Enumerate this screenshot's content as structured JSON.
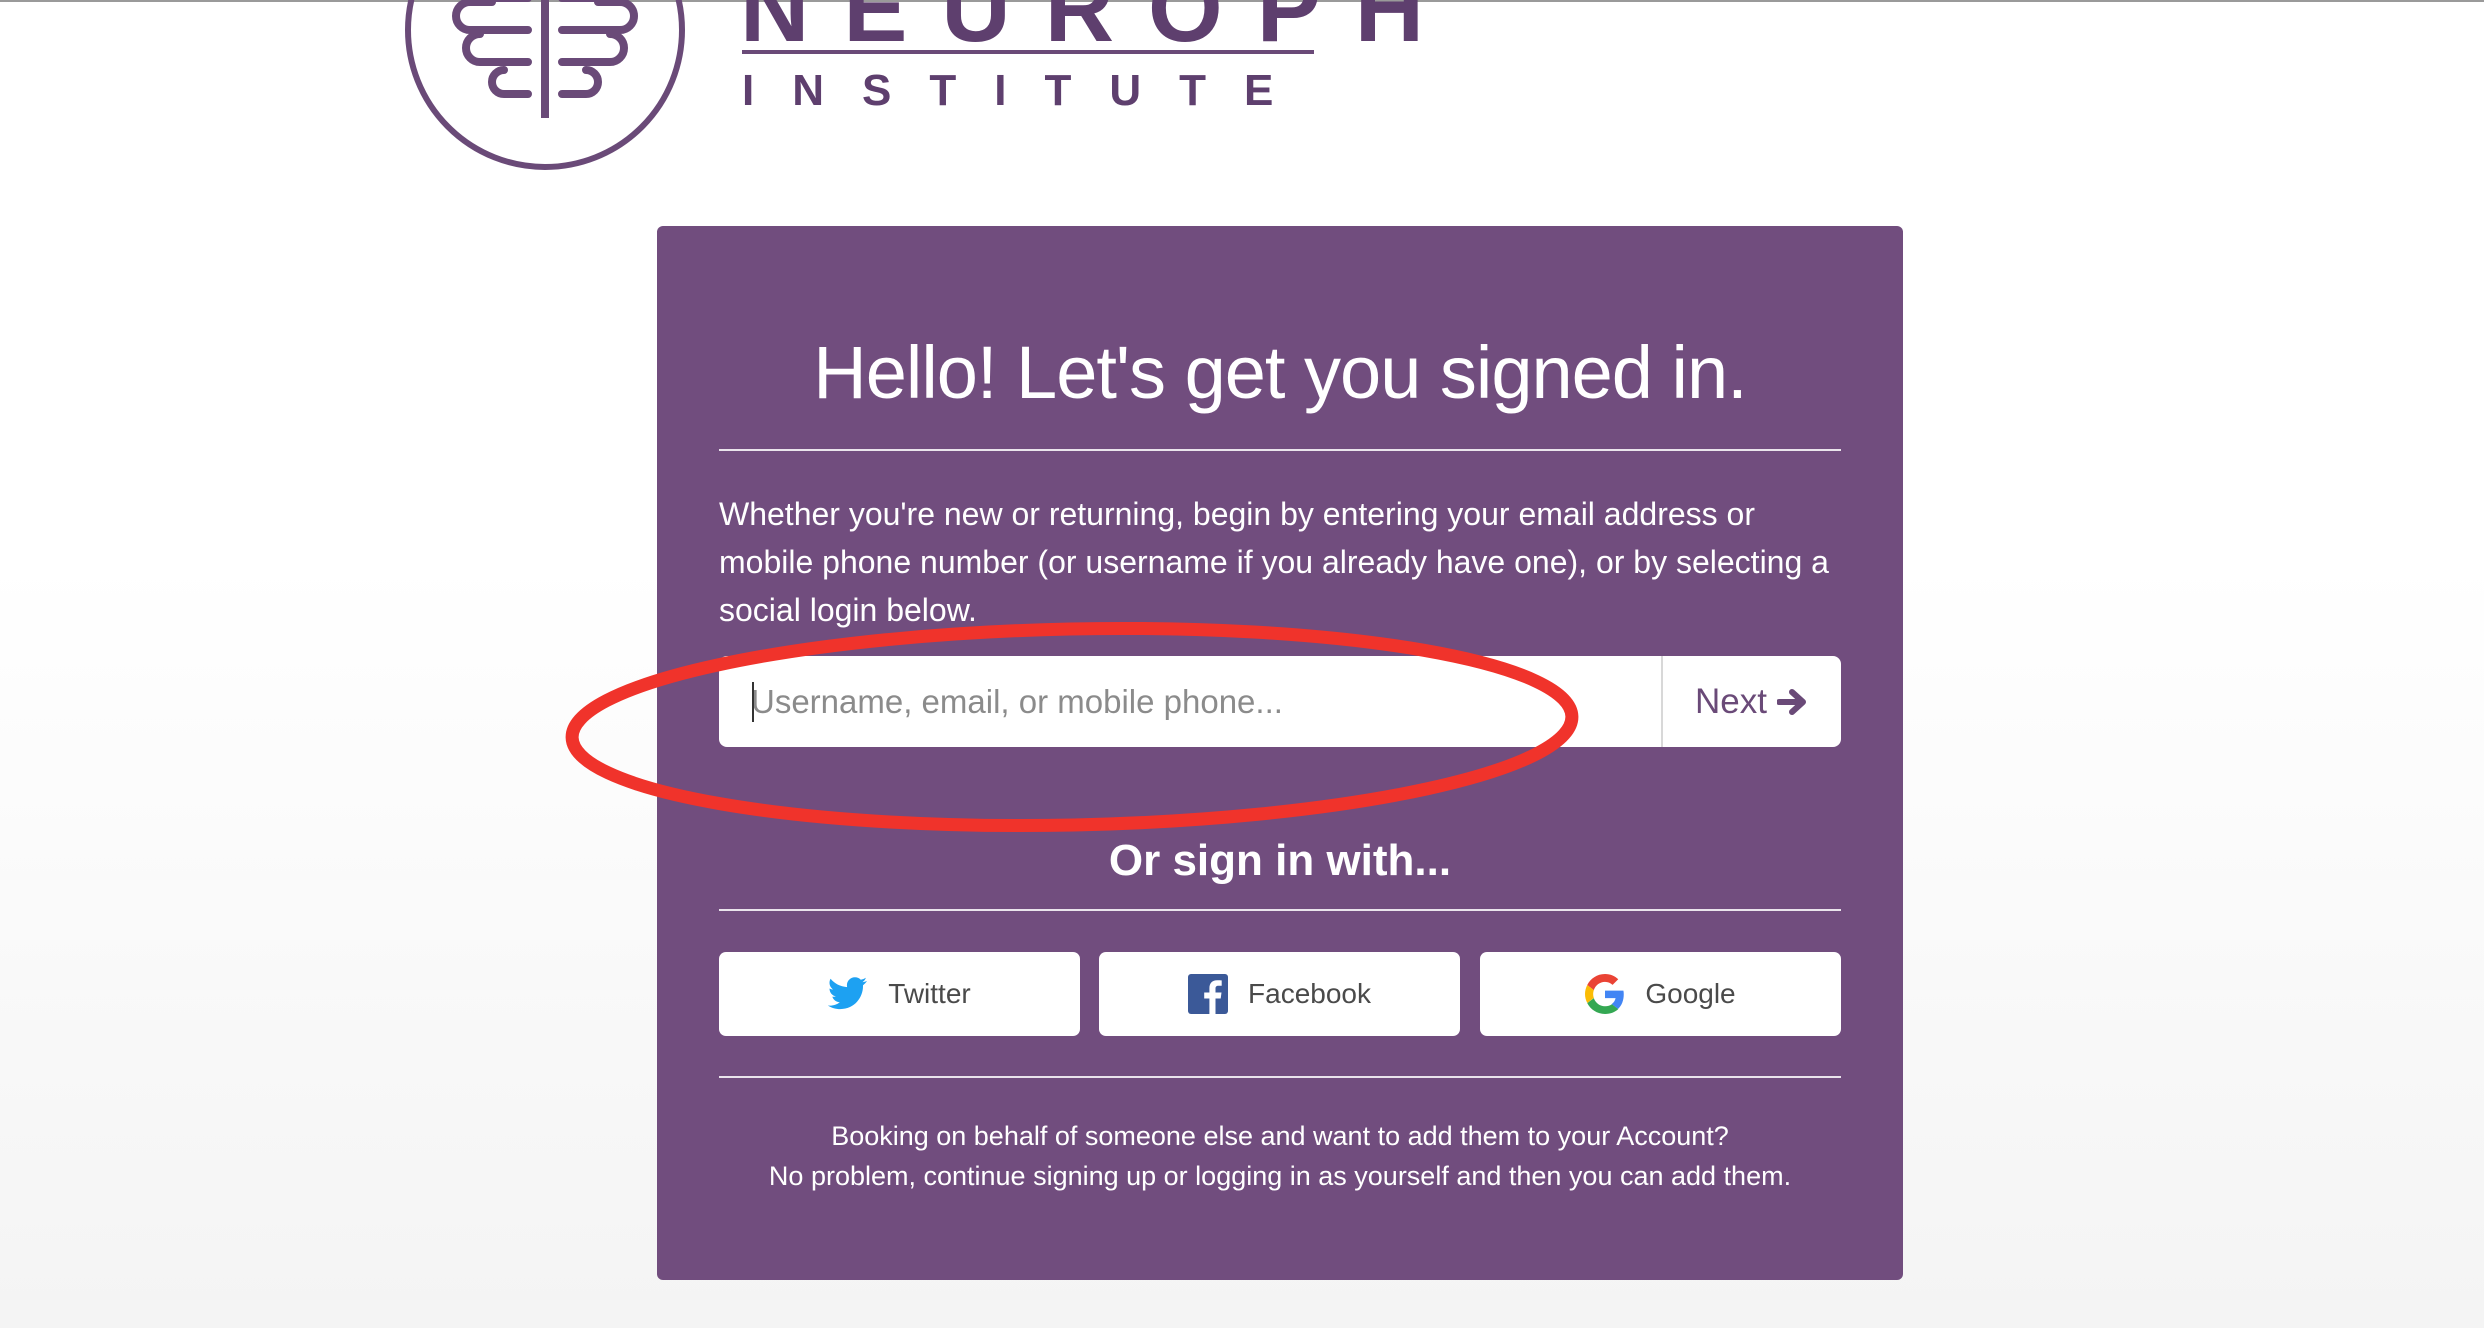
{
  "logo": {
    "word": "NEUROPH",
    "subtitle": "INSTITUTE",
    "brand_color": "#5e3f6e"
  },
  "card": {
    "background": "#714d7e",
    "heading": "Hello! Let's get you signed in.",
    "intro": "Whether you're new or returning, begin by entering your email address or mobile phone number (or username if you already have one), or by selecting a social login below.",
    "login_input": {
      "placeholder": "Username, email, or mobile phone...",
      "value": ""
    },
    "next_label": "Next",
    "next_icon": "arrow-right-icon",
    "alt_heading": "Or sign in with...",
    "social": [
      {
        "label": "Twitter",
        "icon": "twitter-icon"
      },
      {
        "label": "Facebook",
        "icon": "facebook-icon"
      },
      {
        "label": "Google",
        "icon": "google-icon"
      }
    ],
    "footer_line1": "Booking on behalf of someone else and want to add them to your Account?",
    "footer_line2": "No problem, continue signing up or logging in as yourself and then you can add them."
  },
  "annotation": {
    "shape": "ellipse",
    "color": "#f0332b",
    "target": "login-input"
  }
}
